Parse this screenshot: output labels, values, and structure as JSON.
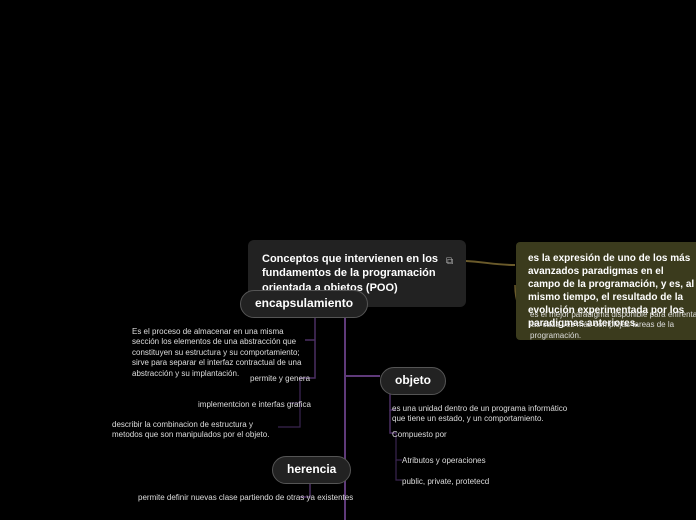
{
  "root": {
    "title": "Conceptos que intervienen en los fundamentos de la programación orientada a objetos (POO)"
  },
  "right": {
    "paradigm": "es la expresión de uno de los más avanzados paradigmas en el campo de la programación, y es, al mismo tiempo, el resultado de la evolución experimentada por los paradigmas anteriores.",
    "best": "es el mejor paradigma disponible para enfrentar las cada vez más complejas tareas de la programación."
  },
  "encaps": {
    "label": "encapsulamiento",
    "desc": "Es el proceso de almacenar en una misma sección los elementos de una abstracción que constituyen su estructura y su comportamiento; sirve para separar el interfaz contractual de una abstracción y su implantación.",
    "permits": "permite y genera",
    "impl": "implementcion e interfas grafica",
    "describe": "describir la combinacion de estructura y metodos que son manipulados por el objeto."
  },
  "herencia": {
    "label": "herencia",
    "desc": "permite definir nuevas clase partiendo de otras ya existentes"
  },
  "objeto": {
    "label": "objeto",
    "desc": "es una unidad dentro de un programa informático que tiene un estado, y un comportamiento.",
    "comp": "Compuesto por",
    "attr": "Atributos y operaciones",
    "access": "public, private, protetecd"
  }
}
